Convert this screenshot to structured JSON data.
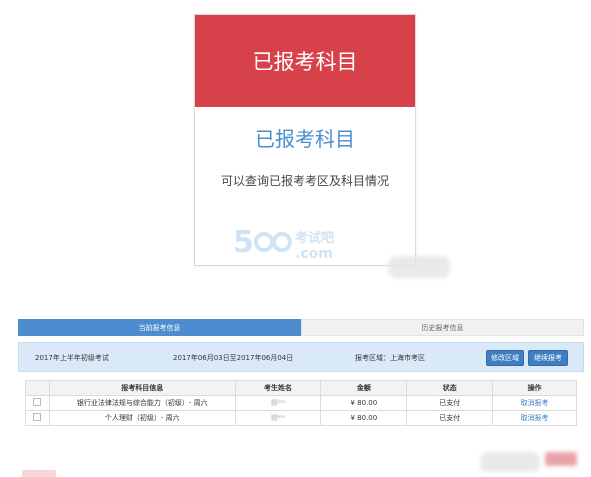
{
  "card": {
    "header": "已报考科目",
    "title": "已报考科目",
    "description": "可以查询已报考考区及科目情况",
    "watermark_number": "5",
    "watermark_text": "考试吧",
    "watermark_domain": ".com"
  },
  "tabs": {
    "current": "当前报考信息",
    "history": "历史报考信息"
  },
  "info": {
    "exam_name": "2017年上半年初级考试",
    "date_range": "2017年06月03日至2017年06月04日",
    "region": "报考区域：上海市考区",
    "modify_label": "修改区域",
    "continue_label": "继续报考"
  },
  "table": {
    "headers": [
      "报考科目信息",
      "考生姓名",
      "金额",
      "状态",
      "操作"
    ],
    "rows": [
      {
        "subject": "银行业法律法规与综合能力（初级）- 周六",
        "name": "顾**",
        "amount": "¥ 80.00",
        "status": "已支付",
        "action": "取消报考"
      },
      {
        "subject": "个人理财（初级）- 周六",
        "name": "顾**",
        "amount": "¥ 80.00",
        "status": "已支付",
        "action": "取消报考"
      }
    ]
  },
  "colors": {
    "header_red": "#d7414a",
    "title_blue": "#4b8fcf",
    "tab_blue": "#4c8ccf",
    "button_blue": "#3f7ec0",
    "info_bg": "#d9e9f7"
  }
}
